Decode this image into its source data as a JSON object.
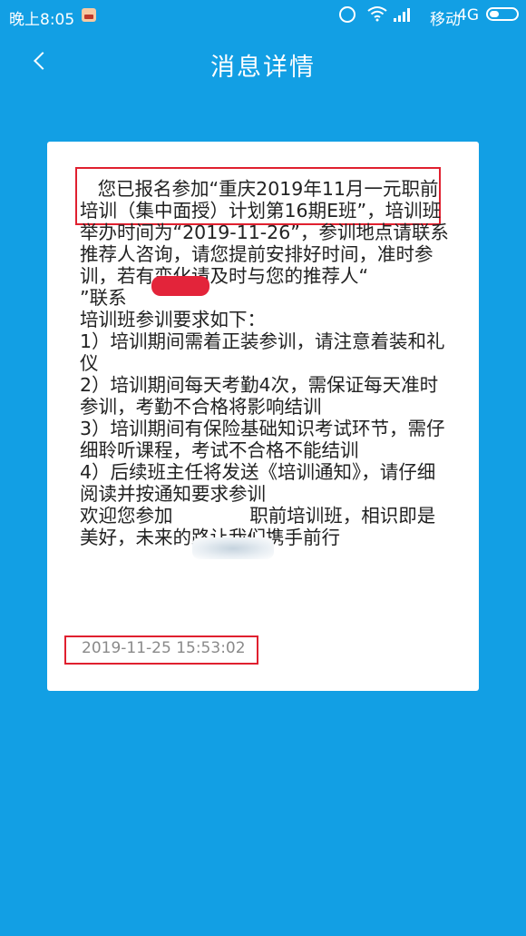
{
  "status_bar": {
    "time": "晚上8:05",
    "carrier": "移动",
    "network": "4G",
    "icons": [
      "app-icon",
      "alarm-icon",
      "wifi-icon",
      "signal-icon",
      "battery-icon"
    ]
  },
  "header": {
    "title": "消息详情",
    "back_icon": "chevron-left-icon"
  },
  "message": {
    "body": "   您已报名参加“重庆2019年11月一元职前培训（集中面授）计划第16期E班”，培训班举办时间为“2019-11-26”，参训地点请联系推荐人咨询，请您提前安排好时间，准时参训，若有变化请及时与您的推荐人“          ”联系\n培训班参训要求如下：\n1）培训期间需着正装参训，请注意着装和礼仪\n2）培训期间每天考勤4次，需保证每天准时参训，考勤不合格将影响结训\n3）培训期间有保险基础知识考试环节，需仔细聆听课程，考试不合格不能结训\n4）后续班主任将发送《培训通知》，请仔细阅读并按通知要求参训\n欢迎您参加             职前培训班，相识即是美好，未来的路让我们携手前行",
    "timestamp": "2019-11-25 15:53:02"
  },
  "colors": {
    "background": "#129fe4",
    "card": "#ffffff",
    "highlight": "#e0202f",
    "timestamp": "#8a8a8a"
  }
}
